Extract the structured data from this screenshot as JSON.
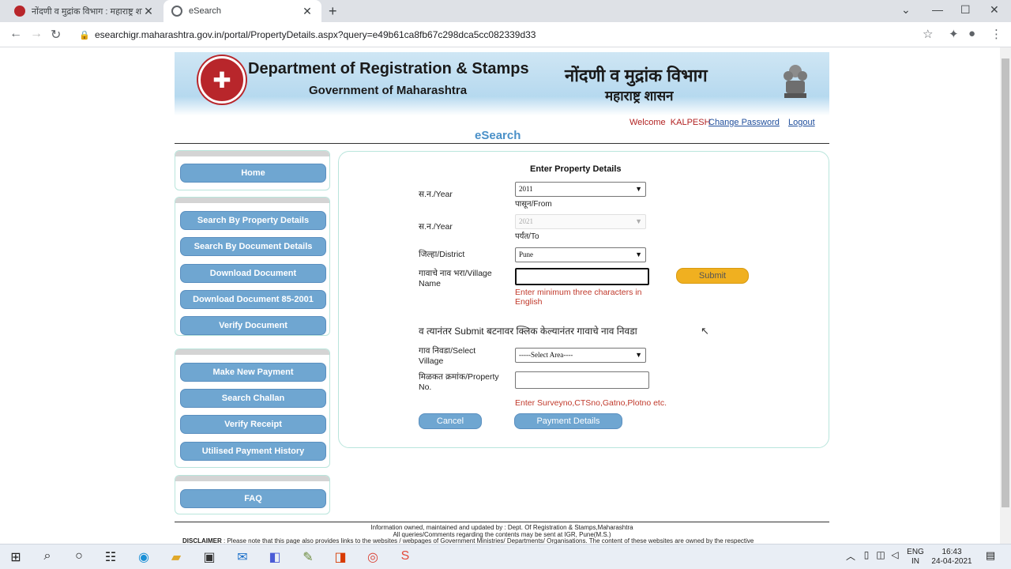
{
  "browser": {
    "tabs": [
      {
        "title": "नोंदणी व मुद्रांक विभाग : महाराष्ट्र शासन",
        "active": false
      },
      {
        "title": "eSearch",
        "active": true
      }
    ],
    "url": "esearchigr.maharashtra.gov.in/portal/PropertyDetails.aspx?query=e49b61ca8fb67c298dca5cc082339d33"
  },
  "banner": {
    "title_en": "Department of Registration & Stamps",
    "subtitle_en": "Government of Maharashtra",
    "title_mr": "नोंदणी व मुद्रांक विभाग",
    "subtitle_mr": "महाराष्ट्र शासन"
  },
  "userbar": {
    "welcome": "Welcome",
    "user": "KALPESH",
    "change_password": "Change Password",
    "logout": "Logout"
  },
  "page_heading": "eSearch",
  "sidebar": {
    "group1": [
      "Home"
    ],
    "group2": [
      "Search By Property Details",
      "Search By Document Details",
      "Download Document",
      "Download Document 85-2001",
      "Verify Document"
    ],
    "group3": [
      "Make New Payment",
      "Search Challan",
      "Verify Receipt",
      "Utilised Payment History"
    ],
    "group4": [
      "FAQ"
    ]
  },
  "form": {
    "title": "Enter Property Details",
    "year_from_label": "स.न./Year",
    "year_from_value": "2011",
    "year_from_sub": "पासून/From",
    "year_to_label": "स.न./Year",
    "year_to_value": "2021",
    "year_to_sub": "पर्यंत/To",
    "district_label": "जिल्हा/District",
    "district_value": "Pune",
    "village_label": "गावाचे नाव भरा/Village Name",
    "village_value": "",
    "village_error": "Enter minimum three characters in English",
    "submit_label": "Submit",
    "note": "व त्यानंतर Submit बटनावर क्लिक केल्यानंतर गावाचे नाव निवडा",
    "select_village_label": "गाव निवडा/Select Village",
    "select_village_value": "-----Select Area----",
    "property_label": "मिळकत क्रमांक/Property No.",
    "property_value": "",
    "property_hint": "Enter Surveyno,CTSno,Gatno,Plotno etc.",
    "cancel_label": "Cancel",
    "payment_label": "Payment Details"
  },
  "footer": {
    "line1": "Information owned, maintained and updated by : Dept. Of Registration & Stamps,Maharashtra",
    "line2": "All queries/Comments regarding the contents may be sent at IGR, Pune(M.S.)",
    "disclaimer_label": "DISCLAIMER",
    "disclaimer_text": ": Please note that this page also provides links to the websites / webpages of Government Ministries/ Departments/ Organisations. The content of these websites are owned by the respective"
  },
  "taskbar": {
    "lang1": "ENG",
    "lang2": "IN",
    "time": "16:43",
    "date": "24-04-2021"
  },
  "colors": {
    "sidebar_button": "#6fa6d1",
    "submit_button": "#f0b020",
    "error_text": "#c0392b",
    "link": "#1f4e9c",
    "heading": "#4a90c8"
  }
}
